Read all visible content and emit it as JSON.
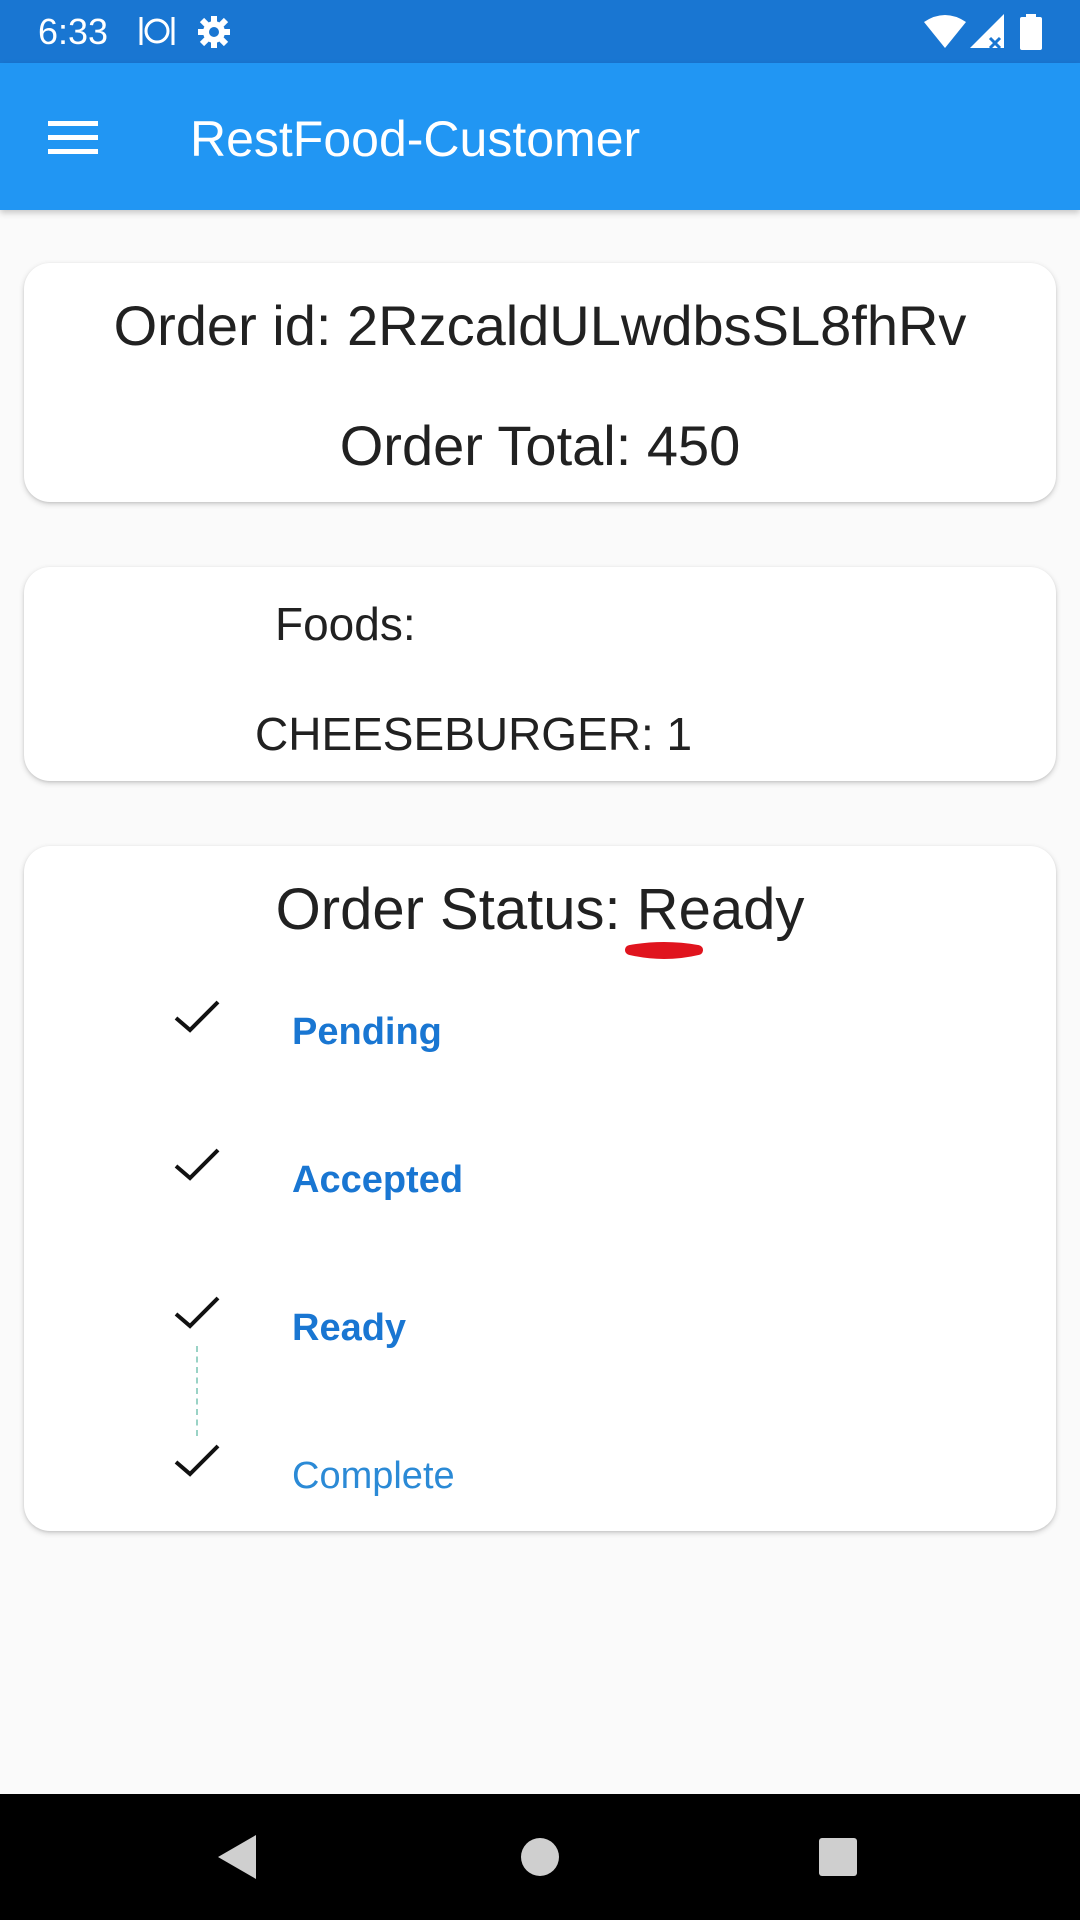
{
  "status_bar": {
    "time": "6:33",
    "icons": [
      "restaurant-icon",
      "settings-gear-icon",
      "wifi-icon",
      "signal-icon",
      "battery-icon"
    ]
  },
  "app_bar": {
    "title": "RestFood-Customer",
    "menu_icon": "hamburger-menu-icon"
  },
  "order_card": {
    "order_id": "Order id: 2RzcaldULwdbsSL8fhRv",
    "order_total": "Order Total: 450"
  },
  "foods_card": {
    "label": "Foods:",
    "items": [
      "CHEESEBURGER: 1"
    ]
  },
  "status_card": {
    "heading": "Order Status: Ready",
    "steps": [
      {
        "label": "Pending",
        "icon": "check-icon"
      },
      {
        "label": "Accepted",
        "icon": "check-icon"
      },
      {
        "label": "Ready",
        "icon": "check-icon"
      },
      {
        "label": "Complete",
        "icon": "check-icon"
      }
    ]
  },
  "nav_bar": {
    "buttons": [
      "back-icon",
      "home-icon",
      "recents-icon"
    ]
  },
  "colors": {
    "status_bar": "#1976d2",
    "app_bar": "#2196f3",
    "step_label": "#1976d2",
    "annotation_red": "#e0141e"
  }
}
